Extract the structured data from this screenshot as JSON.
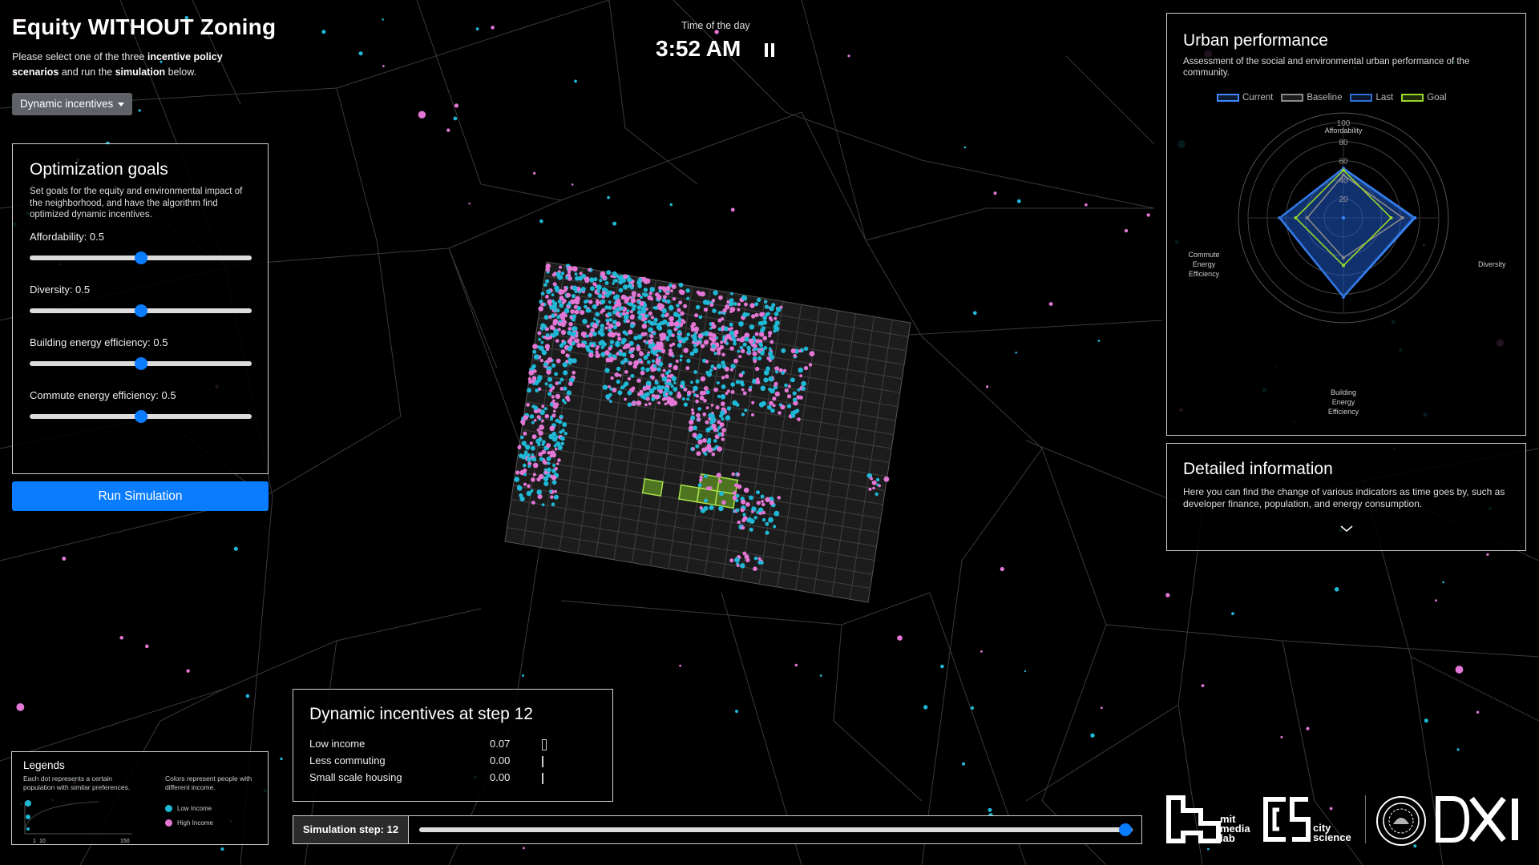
{
  "header": {
    "title": "Equity WITHOUT Zoning",
    "intro_1": "Please select one of the three ",
    "intro_bold_1": "incentive policy scenarios",
    "intro_2": " and run the ",
    "intro_bold_2": "simulation",
    "intro_3": " below.",
    "dropdown_value": "Dynamic incentives"
  },
  "optimization": {
    "title": "Optimization goals",
    "description": "Set goals for the equity and environmental impact of the neighborhood, and have the algorithm find optimized dynamic incentives.",
    "sliders": [
      {
        "label": "Affordability: 0.5",
        "value": 0.5
      },
      {
        "label": "Diversity: 0.5",
        "value": 0.5
      },
      {
        "label": "Building energy efficiency: 0.5",
        "value": 0.5
      },
      {
        "label": "Commute energy efficiency: 0.5",
        "value": 0.5
      }
    ],
    "run_label": "Run Simulation"
  },
  "time": {
    "label": "Time of the day",
    "value": "3:52 AM"
  },
  "performance": {
    "title": "Urban performance",
    "description": "Assessment of the social and environmental urban performance of the community.",
    "legend": [
      {
        "name": "Current",
        "color": "#3d8bff"
      },
      {
        "name": "Baseline",
        "color": "#8a8a8a"
      },
      {
        "name": "Last",
        "color": "#2d6fd6"
      },
      {
        "name": "Goal",
        "color": "#9bd62a"
      }
    ],
    "axes": {
      "top": "Affordability",
      "right": "Diversity",
      "bottom_lines": [
        "Building",
        "Energy",
        "Efficiency"
      ],
      "left_lines": [
        "Commute",
        "Energy",
        "Efficiency"
      ]
    },
    "ticks": [
      "100",
      "80",
      "60",
      "40",
      "20"
    ]
  },
  "chart_data": {
    "type": "radar",
    "axes": [
      "Affordability",
      "Diversity",
      "Building Energy Efficiency",
      "Commute Energy Efficiency"
    ],
    "range": [
      0,
      100
    ],
    "series": [
      {
        "name": "Current",
        "values": [
          52,
          75,
          83,
          67
        ]
      },
      {
        "name": "Baseline",
        "values": [
          45,
          62,
          42,
          38
        ]
      },
      {
        "name": "Last",
        "values": [
          51,
          73,
          82,
          66
        ]
      },
      {
        "name": "Goal",
        "values": [
          50,
          50,
          50,
          50
        ]
      }
    ]
  },
  "detail": {
    "title": "Detailed information",
    "description": "Here you can find the change of various indicators as time goes by, such as developer finance, population, and energy consumption."
  },
  "incentives": {
    "title": "Dynamic incentives at step 12",
    "rows": [
      {
        "label": "Low income",
        "value": "0.07",
        "level": 0.07
      },
      {
        "label": "Less commuting",
        "value": "0.00",
        "level": 0.0
      },
      {
        "label": "Small scale housing",
        "value": "0.00",
        "level": 0.0
      }
    ]
  },
  "legends": {
    "title": "Legends",
    "size_desc": "Each dot represents a certain population with similar preferences.",
    "color_desc": "Colors represent people with different income.",
    "size_ticks": [
      "1",
      "10",
      "150"
    ],
    "low_income": "Low Income",
    "high_income": "High Income",
    "low_color": "#1fb8d6",
    "high_color": "#e477d6"
  },
  "simulation": {
    "step_label": "Simulation step: 12",
    "step_progress": 0.99
  },
  "logos": {
    "media_lab": [
      "mit",
      "media",
      "lab"
    ],
    "city_science": [
      "city",
      "science"
    ]
  }
}
